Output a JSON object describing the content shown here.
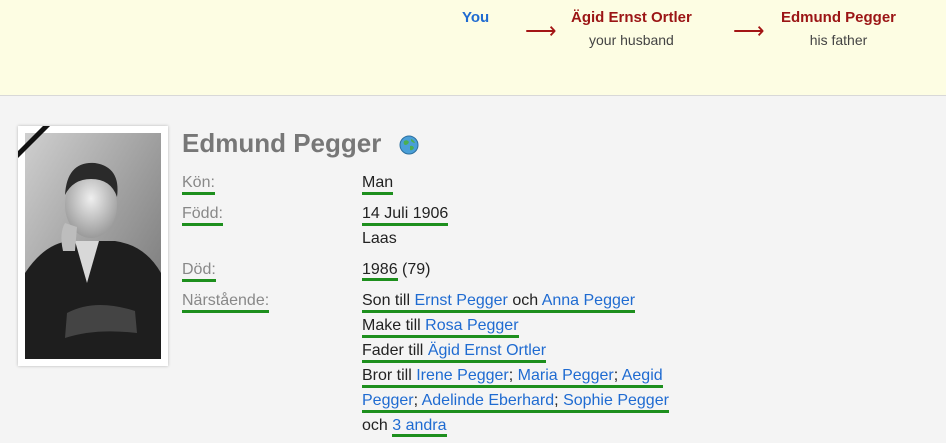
{
  "relationship_path": {
    "you": "You",
    "step1": {
      "name": "Ägid Ernst Ortler",
      "relation": "your husband"
    },
    "step2": {
      "name": "Edmund Pegger",
      "relation": "his father"
    },
    "arrow": "⟶"
  },
  "profile": {
    "name": "Edmund Pegger",
    "labels": {
      "gender": "Kön:",
      "born": "Född:",
      "died": "Död:",
      "relatives": "Närstående:"
    },
    "gender": "Man",
    "born_date": "14 Juli 1906",
    "born_place": "Laas",
    "died_year": "1986",
    "died_age": "(79)"
  },
  "relatives": {
    "son_of": "Son till",
    "father": "Ernst Pegger",
    "and1": "och",
    "mother": "Anna Pegger",
    "husband_of": "Make till",
    "wife": "Rosa Pegger",
    "father_of": "Fader till",
    "child": "Ägid Ernst Ortler",
    "brother_of": "Bror till",
    "sibling1": "Irene Pegger",
    "sep": ";",
    "sibling2": "Maria Pegger",
    "sibling3_part1": "Aegid",
    "sibling3_part2": "Pegger",
    "sibling4": "Adelinde Eberhard",
    "sibling5": "Sophie Pegger",
    "and2": "och",
    "more": "3 andra"
  },
  "colors": {
    "accent_link": "#1f6bd1",
    "dark_red": "#9b1515",
    "underline": "#1d8f1d"
  }
}
